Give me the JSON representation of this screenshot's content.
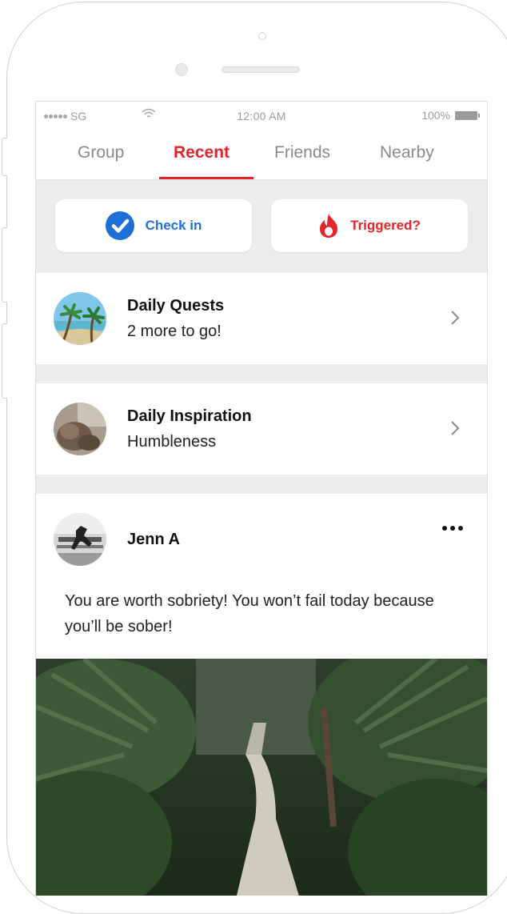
{
  "status_bar": {
    "carrier": "SG",
    "time": "12:00 AM",
    "battery": "100%"
  },
  "tabs": [
    {
      "label": "Group"
    },
    {
      "label": "Recent",
      "active": true
    },
    {
      "label": "Friends"
    },
    {
      "label": "Nearby"
    }
  ],
  "actions": {
    "check_in": "Check in",
    "triggered": "Triggered?"
  },
  "daily_quests": {
    "title": "Daily Quests",
    "subtitle": "2 more to go!"
  },
  "daily_inspiration": {
    "title": "Daily Inspiration",
    "subtitle": "Humbleness"
  },
  "post": {
    "author": "Jenn A",
    "text": "You are worth sobriety! You won’t fail today because you’ll be sober!"
  },
  "colors": {
    "accent_red": "#e1252b",
    "accent_blue": "#1f6fd8",
    "background": "#ececee"
  },
  "icons": [
    "checkmark-icon",
    "flame-icon",
    "chevron-right-icon",
    "more-icon",
    "wifi-icon",
    "battery-icon"
  ]
}
